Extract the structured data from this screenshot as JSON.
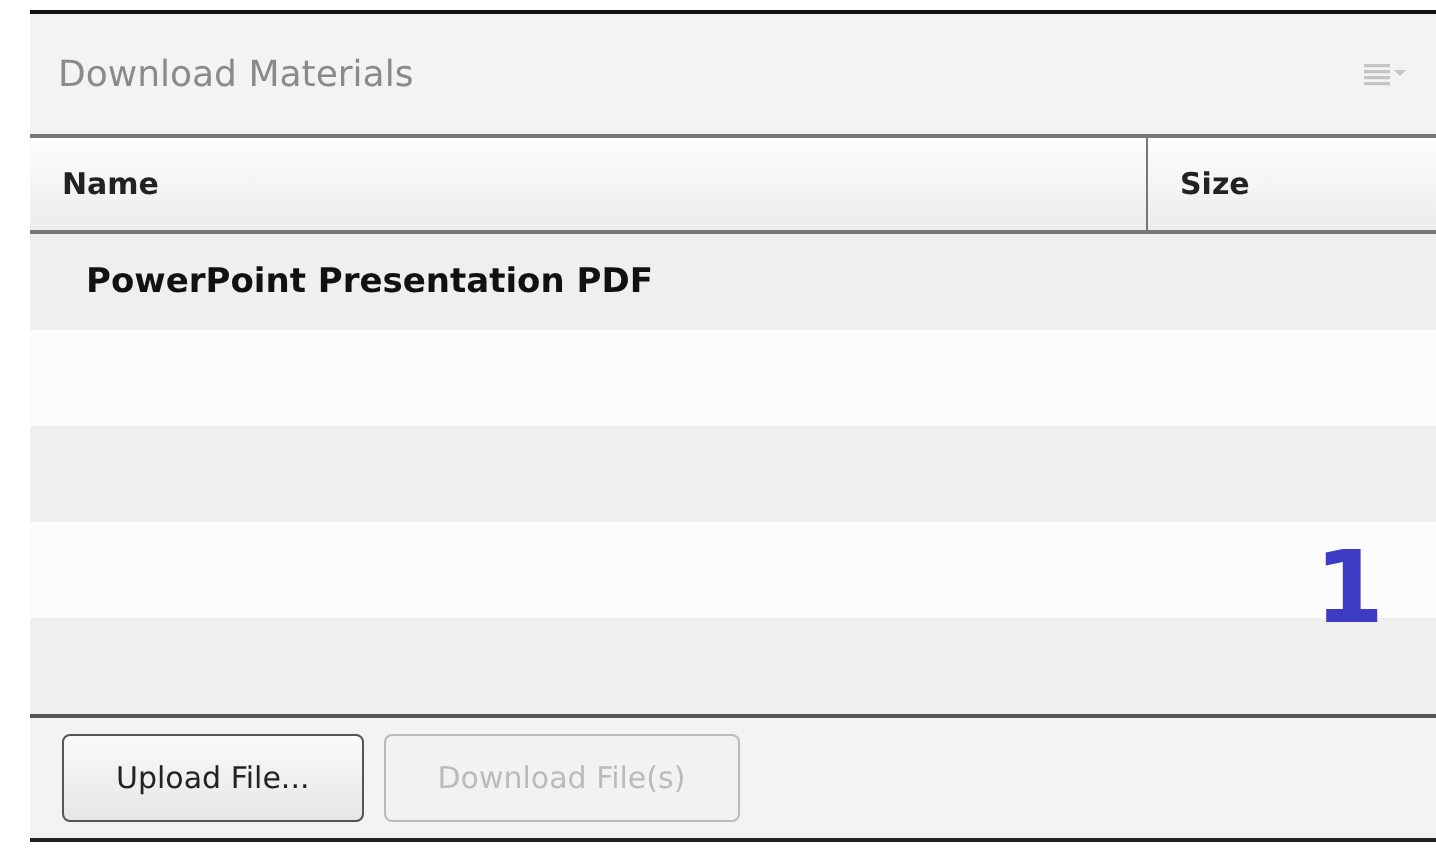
{
  "panel": {
    "title": "Download Materials"
  },
  "table": {
    "columns": [
      "Name",
      "Size"
    ],
    "rows": [
      {
        "name": "PowerPoint Presentation PDF"
      }
    ]
  },
  "buttons": [
    {
      "label": "Upload File...",
      "disabled": false
    },
    {
      "label": "Download File(s)",
      "disabled": true
    }
  ],
  "annotation": "1"
}
